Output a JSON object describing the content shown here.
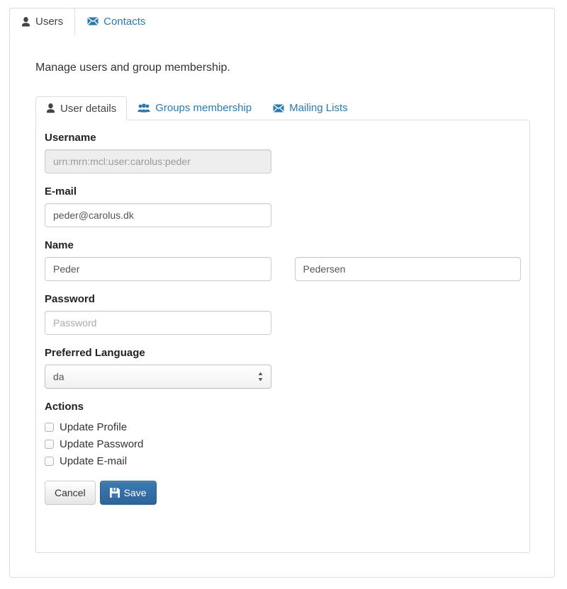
{
  "outer_tabs": [
    {
      "label": "Users",
      "icon": "user-icon",
      "active": true
    },
    {
      "label": "Contacts",
      "icon": "envelope-icon",
      "active": false
    }
  ],
  "description": "Manage users and group membership.",
  "inner_tabs": [
    {
      "label": "User details",
      "icon": "user-icon",
      "active": true
    },
    {
      "label": "Groups membership",
      "icon": "users-group-icon",
      "active": false
    },
    {
      "label": "Mailing Lists",
      "icon": "envelope-icon",
      "active": false
    }
  ],
  "form": {
    "username": {
      "label": "Username",
      "value": "urn:mrn:mcl:user:carolus:peder",
      "disabled": true
    },
    "email": {
      "label": "E-mail",
      "value": "peder@carolus.dk"
    },
    "name": {
      "label": "Name",
      "first_value": "Peder",
      "last_value": "Pedersen"
    },
    "password": {
      "label": "Password",
      "value": "",
      "placeholder": "Password"
    },
    "language": {
      "label": "Preferred Language",
      "selected": "da",
      "options": [
        "da"
      ]
    },
    "actions": {
      "label": "Actions",
      "checkboxes": [
        {
          "label": "Update Profile",
          "checked": false
        },
        {
          "label": "Update Password",
          "checked": false
        },
        {
          "label": "Update E-mail",
          "checked": false
        }
      ]
    },
    "buttons": {
      "cancel": "Cancel",
      "save": "Save",
      "save_icon": "floppy-disk-icon"
    }
  },
  "colors": {
    "link_blue": "#2a7ab0",
    "primary_button": "#3b7bb0",
    "border_grey": "#dddddd",
    "disabled_bg": "#eeeeee"
  }
}
